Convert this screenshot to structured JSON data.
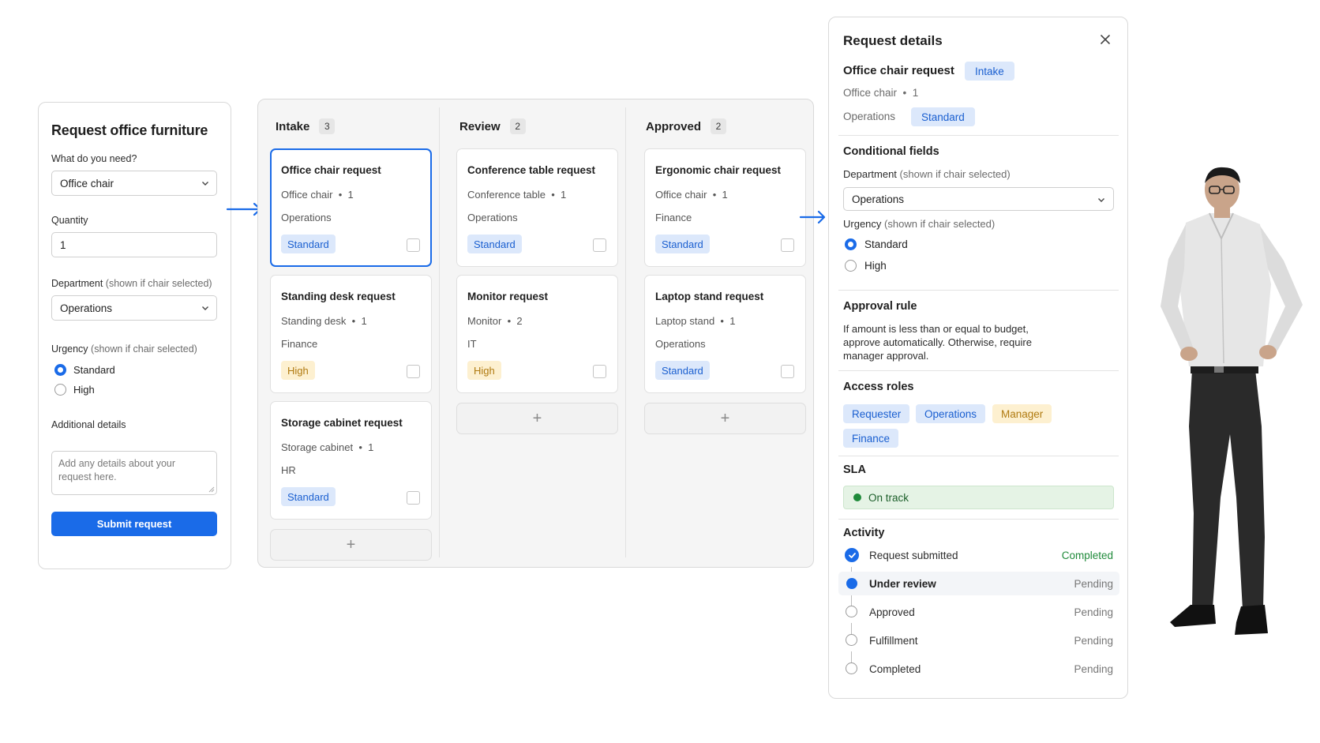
{
  "form": {
    "title": "Request office furniture",
    "need_label": "What do you need?",
    "need_value": "Office chair",
    "quantity_label": "Quantity",
    "quantity_value": "1",
    "department_label": "Department",
    "department_hint": "(shown if chair selected)",
    "department_value": "Operations",
    "urgency_label": "Urgency",
    "urgency_hint": "(shown if chair selected)",
    "urgency_options": [
      "Standard",
      "High"
    ],
    "urgency_selected": "Standard",
    "details_label": "Additional details",
    "details_placeholder": "Add any details about your request here.",
    "submit_label": "Submit request"
  },
  "board": {
    "columns": [
      {
        "title": "Intake",
        "count": "3",
        "cards": [
          {
            "title": "Office chair request",
            "item": "Office chair",
            "qty": "1",
            "department": "Operations",
            "urgency": "Standard",
            "selected": true
          },
          {
            "title": "Standing desk request",
            "item": "Standing desk",
            "qty": "1",
            "department": "Finance",
            "urgency": "High"
          },
          {
            "title": "Storage cabinet request",
            "item": "Storage cabinet",
            "qty": "1",
            "department": "HR",
            "urgency": "Standard"
          }
        ]
      },
      {
        "title": "Review",
        "count": "2",
        "cards": [
          {
            "title": "Conference table request",
            "item": "Conference table",
            "qty": "1",
            "department": "Operations",
            "urgency": "Standard"
          },
          {
            "title": "Monitor request",
            "item": "Monitor",
            "qty": "2",
            "department": "IT",
            "urgency": "High"
          }
        ]
      },
      {
        "title": "Approved",
        "count": "2",
        "cards": [
          {
            "title": "Ergonomic chair request",
            "item": "Office chair",
            "qty": "1",
            "department": "Finance",
            "urgency": "Standard"
          },
          {
            "title": "Laptop stand request",
            "item": "Laptop stand",
            "qty": "1",
            "department": "Operations",
            "urgency": "Standard"
          }
        ]
      }
    ],
    "add_symbol": "+",
    "separator": "•"
  },
  "details": {
    "title": "Request details",
    "request_title": "Office chair request",
    "stage_badge": "Intake",
    "item": "Office chair",
    "separator": "•",
    "qty": "1",
    "department": "Operations",
    "urgency_badge": "Standard",
    "conditional_title": "Conditional fields",
    "department_label": "Department",
    "department_hint": "(shown if chair selected)",
    "department_value": "Operations",
    "urgency_label": "Urgency",
    "urgency_hint": "(shown if chair selected)",
    "urgency_options": [
      "Standard",
      "High"
    ],
    "urgency_selected": "Standard",
    "approval_title": "Approval rule",
    "approval_text": "If amount is less than or equal to budget, approve automatically. Otherwise, require manager approval.",
    "access_title": "Access roles",
    "roles": [
      "Requester",
      "Operations",
      "Manager",
      "Finance"
    ],
    "sla_title": "SLA",
    "sla_status": "On track",
    "activity_title": "Activity",
    "activity": [
      {
        "label": "Request submitted",
        "status": "Completed",
        "state": "done"
      },
      {
        "label": "Under review",
        "status": "Pending",
        "state": "current"
      },
      {
        "label": "Approved",
        "status": "Pending",
        "state": "todo"
      },
      {
        "label": "Fulfillment",
        "status": "Pending",
        "state": "todo"
      },
      {
        "label": "Completed",
        "status": "Pending",
        "state": "todo"
      }
    ]
  },
  "colors": {
    "accent": "#1a6be8",
    "standard_badge_bg": "#dce8fb",
    "high_badge_bg": "#fdf0d0",
    "sla_ok": "#1f8a3a"
  },
  "icons": [
    "chevron-down-icon",
    "close-icon",
    "arrow-right-icon",
    "check-icon",
    "plus-icon"
  ]
}
